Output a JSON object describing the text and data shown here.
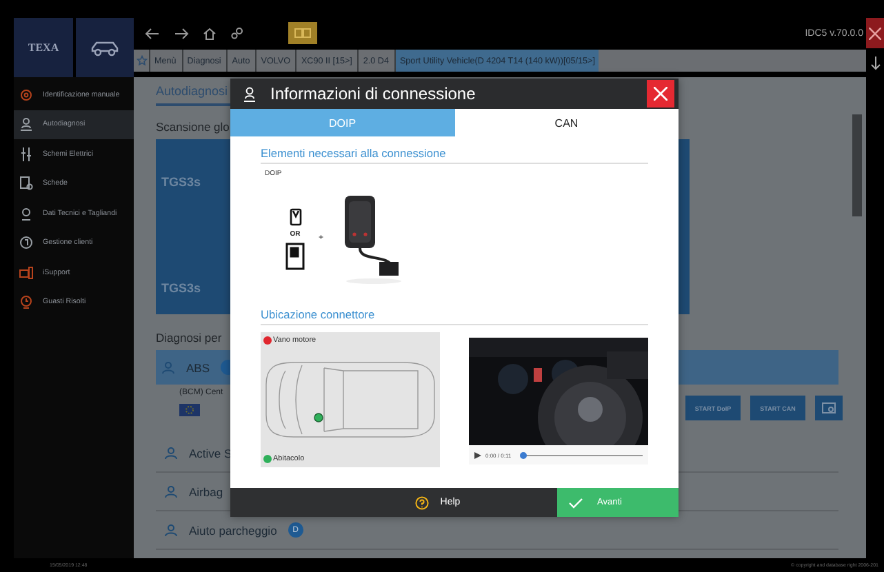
{
  "header": {
    "logo": "TEXA",
    "version": "IDC5 v.70.0.0"
  },
  "breadcrumb": [
    {
      "label": "Menù",
      "selected": false
    },
    {
      "label": "Diagnosi",
      "selected": false
    },
    {
      "label": "Auto",
      "selected": false
    },
    {
      "label": "VOLVO",
      "selected": false
    },
    {
      "label": "XC90 II [15>]",
      "selected": false
    },
    {
      "label": "2.0 D4",
      "selected": false
    },
    {
      "label": "Sport Utility Vehicle(D 4204 T14 (140 kW))[05/15>]",
      "selected": true
    }
  ],
  "sidebar": {
    "items": [
      {
        "label": "Identificazione manuale",
        "color": "#b8431c",
        "selected": false
      },
      {
        "label": "Autodiagnosi",
        "color": "#9aa0a6",
        "selected": true
      },
      {
        "label": "Schemi Elettrici",
        "color": "#9aa0a6",
        "selected": false
      },
      {
        "label": "Schede",
        "color": "#9aa0a6",
        "selected": false
      },
      {
        "label": "Dati Tecnici e Tagliandi",
        "color": "#9aa0a6",
        "selected": false
      },
      {
        "label": "Gestione clienti",
        "color": "#9aa0a6",
        "selected": false
      },
      {
        "label": "iSupport",
        "color": "#b8431c",
        "selected": false
      },
      {
        "label": "Guasti Risolti",
        "color": "#b8431c",
        "selected": false
      }
    ]
  },
  "main": {
    "tab": "Autodiagnosi",
    "section": "Scansione glo",
    "tile_labels": [
      "TGS3s",
      "TGS3s"
    ],
    "group_title": "Diagnosi per",
    "systems": [
      {
        "label": "ABS",
        "selected": true,
        "badge_icon": true
      },
      {
        "label": "Active S",
        "selected": false,
        "badge_icon": false
      },
      {
        "label": "Airbag",
        "selected": false,
        "badge_icon": false
      },
      {
        "label": "Aiuto parcheggio",
        "selected": false,
        "badge_icon": false,
        "badge": "D"
      }
    ],
    "abs_detail": "(BCM) Cent",
    "actions": [
      "START DoIP",
      "START CAN"
    ]
  },
  "modal": {
    "title": "Informazioni di connessione",
    "tabs": [
      {
        "label": "DOIP",
        "selected": true
      },
      {
        "label": "CAN",
        "selected": false
      }
    ],
    "requirements_heading": "Elementi necessari alla connessione",
    "interface_label": "DOIP",
    "or_label": "OR",
    "plus_label": "+",
    "location_heading": "Ubicazione connettore",
    "legend": [
      {
        "label": "Vano motore",
        "color": "#e0262e"
      },
      {
        "label": "Abitacolo",
        "color": "#2fb05a"
      }
    ],
    "video": {
      "time": "0:00 / 0:11",
      "level": 0.02
    },
    "buttons": {
      "help": "Help",
      "next": "Avanti"
    }
  },
  "status_bar": {
    "datetime": "15/05/2019 12:48",
    "copyright": "© copyright and database right 2006-201"
  }
}
